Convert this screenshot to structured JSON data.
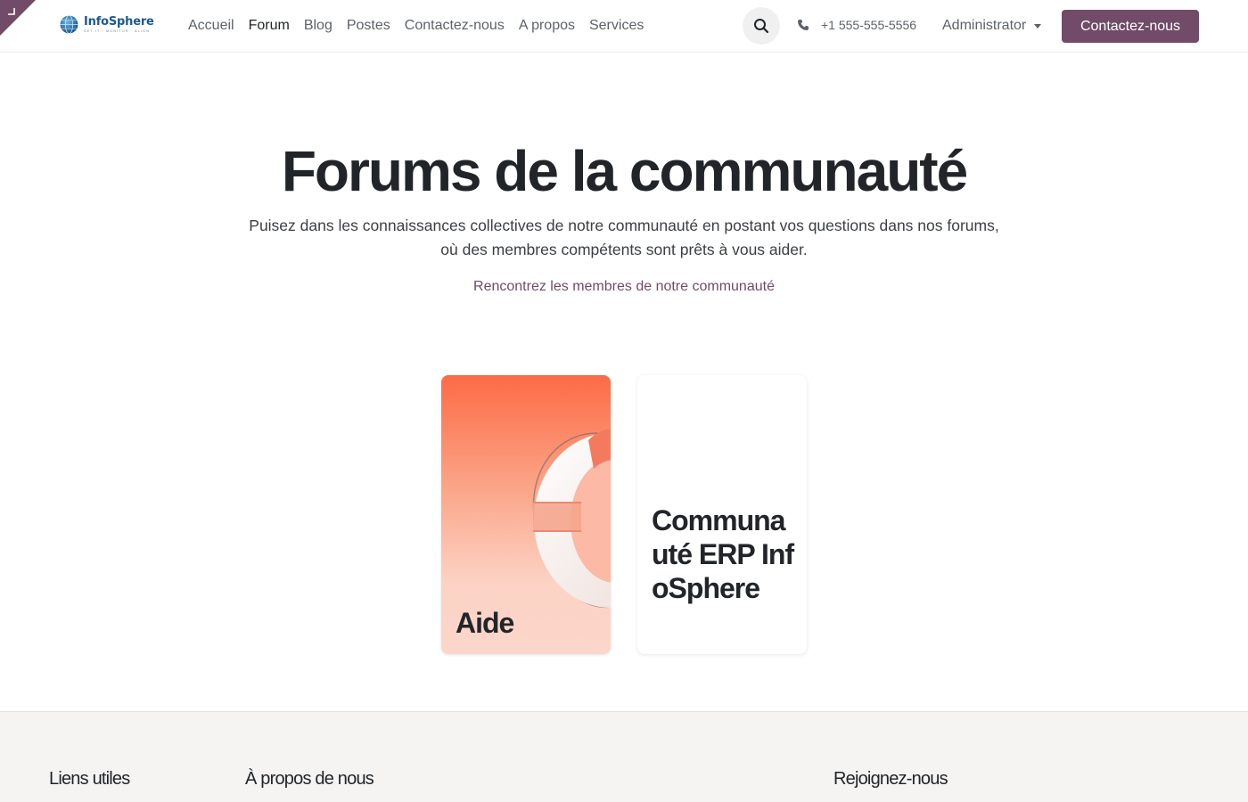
{
  "header": {
    "logo": {
      "name": "InfoSphere",
      "tagline": "SET IT · MONITOR · ALIGN"
    },
    "menu": [
      {
        "label": "Accueil"
      },
      {
        "label": "Forum"
      },
      {
        "label": "Blog"
      },
      {
        "label": "Postes"
      },
      {
        "label": "Contactez-nous"
      },
      {
        "label": "A propos"
      },
      {
        "label": "Services"
      }
    ],
    "active_menu": "Forum",
    "phone": "+1 555-555-5556",
    "user": "Administrator",
    "cta_label": "Contactez-nous"
  },
  "hero": {
    "title": "Forums de la communauté",
    "subtitle_line1": "Puisez dans les connaissances collectives de notre communauté en postant vos questions dans nos forums,",
    "subtitle_line2": "où des membres compétents sont prêts à vous aider.",
    "members_link": "Rencontrez les membres de notre communauté"
  },
  "forums": [
    {
      "title": "Aide"
    },
    {
      "title": "Communauté ERP InfoSphere"
    }
  ],
  "footer": {
    "headings": [
      "Liens utiles",
      "À propos de nous",
      "Rejoignez-nous"
    ]
  },
  "colors": {
    "brand": "#714b67",
    "nav_text": "#5c636a",
    "footer_bg": "#f5f4f3"
  },
  "icons": [
    "edit-mode-corner-icon",
    "globe-logo-icon",
    "search-icon",
    "phone-icon",
    "caret-down-icon",
    "lifebuoy-illustration"
  ]
}
